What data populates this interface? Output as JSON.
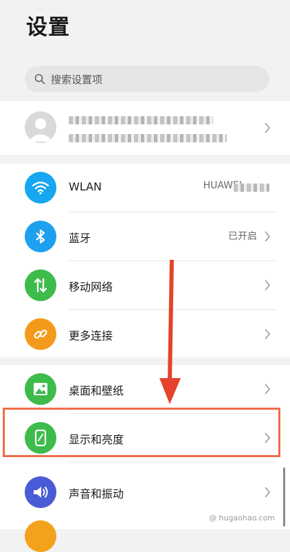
{
  "header": {
    "title": "设置"
  },
  "search": {
    "placeholder": "搜索设置项"
  },
  "account": {
    "avatar_icon": "person-icon",
    "line1_blurred": true,
    "line2_blurred": true
  },
  "groups": {
    "network": {
      "items": [
        {
          "label": "WLAN",
          "value": "HUAWEI",
          "icon": "wifi-icon",
          "icon_color": "#17a6f0"
        },
        {
          "label": "蓝牙",
          "value": "已开启",
          "icon": "bluetooth-icon",
          "icon_color": "#1ea0ef"
        },
        {
          "label": "移动网络",
          "value": "",
          "icon": "mobile-data-icon",
          "icon_color": "#3dbb4b"
        },
        {
          "label": "更多连接",
          "value": "",
          "icon": "link-icon",
          "icon_color": "#f39a1c"
        }
      ]
    },
    "display": {
      "items": [
        {
          "label": "桌面和壁纸",
          "icon": "image-icon",
          "icon_color": "#3dbb4b"
        },
        {
          "label": "显示和亮度",
          "icon": "brightness-icon",
          "icon_color": "#3dbb4b",
          "highlighted": true
        },
        {
          "label": "声音和振动",
          "icon": "speaker-icon",
          "icon_color": "#4a5bd6"
        }
      ]
    }
  },
  "annotation": {
    "arrow_color": "#e5432b",
    "box_color": "#ee6c47"
  },
  "watermark": "@ hugaohao.com"
}
